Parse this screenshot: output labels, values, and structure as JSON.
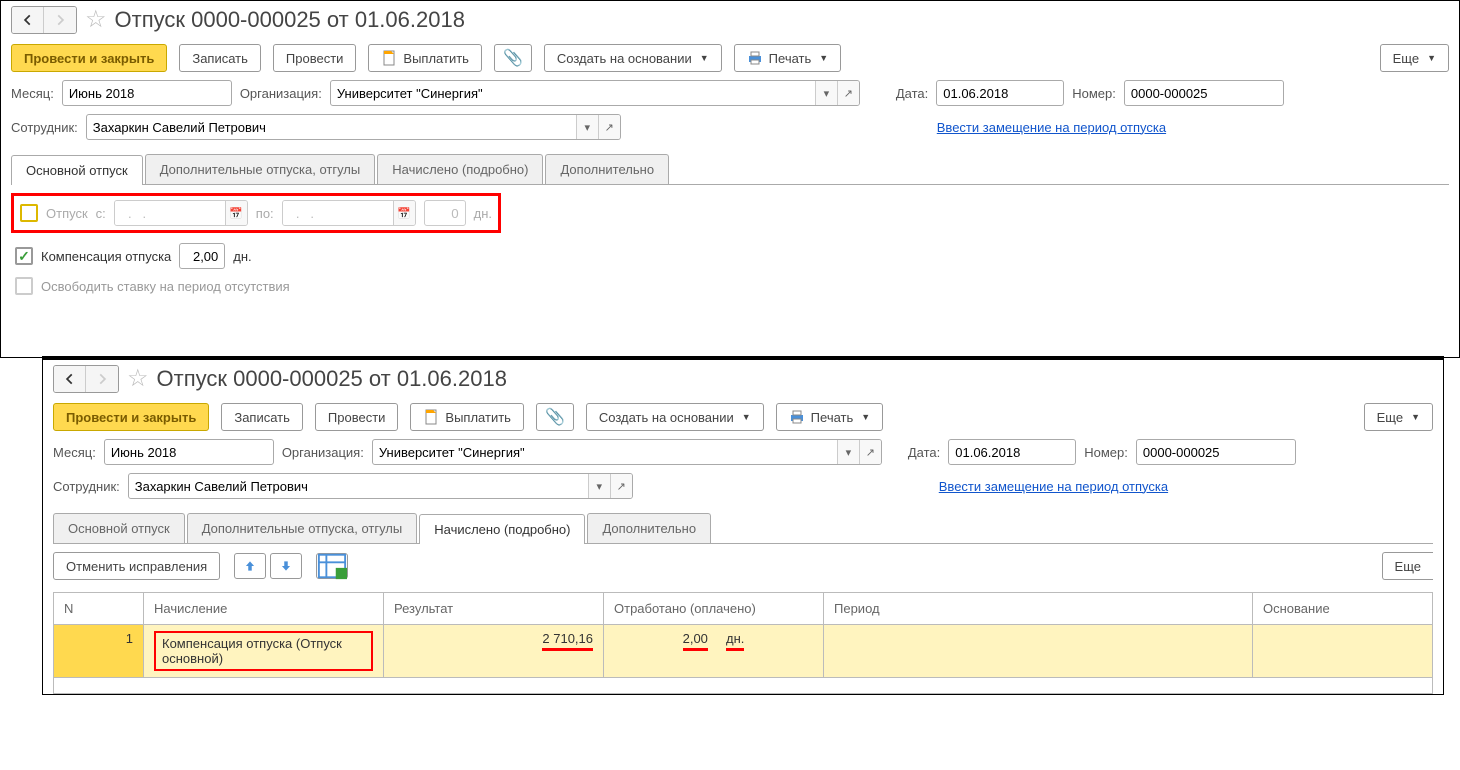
{
  "header": {
    "title": "Отпуск 0000-000025 от 01.06.2018"
  },
  "toolbar": {
    "save_close": "Провести и закрыть",
    "record": "Записать",
    "post": "Провести",
    "pay": "Выплатить",
    "create_based": "Создать на основании",
    "print": "Печать",
    "more": "Еще"
  },
  "fields": {
    "month_label": "Месяц:",
    "month_value": "Июнь 2018",
    "org_label": "Организация:",
    "org_value": "Университет \"Синергия\"",
    "date_label": "Дата:",
    "date_value": "01.06.2018",
    "number_label": "Номер:",
    "number_value": "0000-000025",
    "employee_label": "Сотрудник:",
    "employee_value": "Захаркин Савелий Петрович",
    "substitution_link": "Ввести замещение на период отпуска"
  },
  "tabs": {
    "main": "Основной отпуск",
    "additional": "Дополнительные отпуска, отгулы",
    "accrued": "Начислено (подробно)",
    "extra": "Дополнительно"
  },
  "vacation_row": {
    "label": "Отпуск",
    "from_label": "с:",
    "from_placeholder": "  .   .    ",
    "to_label": "по:",
    "to_placeholder": "  .   .    ",
    "days_value": "0",
    "days_unit": "дн."
  },
  "comp_row": {
    "label": "Компенсация отпуска",
    "value": "2,00",
    "unit": "дн."
  },
  "free_row": {
    "label": "Освободить ставку на период отсутствия"
  },
  "sub_toolbar": {
    "cancel": "Отменить исправления",
    "more": "Еще"
  },
  "table": {
    "headers": {
      "n": "N",
      "accrual": "Начисление",
      "result": "Результат",
      "worked": "Отработано (оплачено)",
      "period": "Период",
      "basis": "Основание"
    },
    "row": {
      "n": "1",
      "accrual": "Компенсация отпуска (Отпуск основной)",
      "result": "2 710,16",
      "worked_val": "2,00",
      "worked_unit": "дн."
    }
  }
}
